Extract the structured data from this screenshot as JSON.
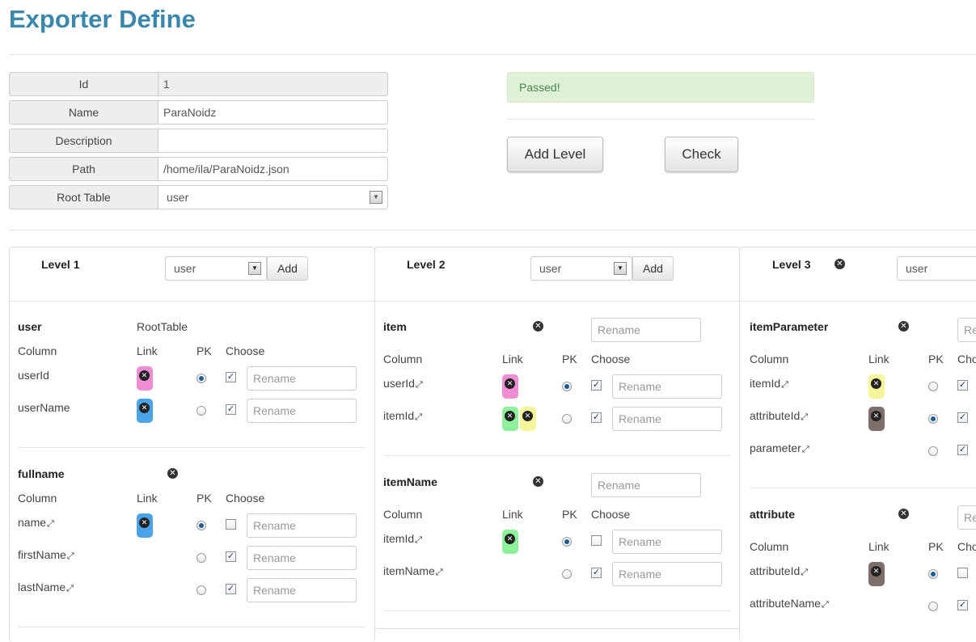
{
  "title": "Exporter Define",
  "form": {
    "id_label": "Id",
    "id_value": "1",
    "name_label": "Name",
    "name_value": "ParaNoidz",
    "description_label": "Description",
    "description_value": "",
    "path_label": "Path",
    "path_value": "/home/ila/ParaNoidz.json",
    "root_table_label": "Root Table",
    "root_table_value": "user"
  },
  "status": {
    "message": "Passed!"
  },
  "buttons": {
    "add_level": "Add Level",
    "check": "Check"
  },
  "colors": {
    "heading": "#3a87ad",
    "alert_bg": "#dff0d8",
    "alert_text": "#468847",
    "chip_pink": "#f08cd4",
    "chip_blue": "#4aa3e8",
    "chip_yellow": "#f5f59a",
    "chip_green": "#8ef09a",
    "chip_brown": "#7e6f6b"
  },
  "common": {
    "column_header": "Column",
    "link_header": "Link",
    "pk_header": "PK",
    "choose_header": "Choose",
    "rename_placeholder": "Rename",
    "remove_icon": "⊗",
    "add_label": "Add",
    "linked_icon": "link-icon"
  },
  "levels": [
    {
      "label": "Level 1",
      "table_select": "user",
      "tables": [
        {
          "name": "user",
          "tag": "RootTable"
        },
        {
          "name": "fullname"
        }
      ]
    },
    {
      "label": "Level 2",
      "table_select": "user",
      "tables": [
        {
          "name": "item"
        },
        {
          "name": "itemName"
        }
      ]
    },
    {
      "label": "Level 3",
      "table_select": "user",
      "tables": [
        {
          "name": "itemParameter"
        },
        {
          "name": "attribute"
        }
      ]
    }
  ],
  "columns": {
    "l1_user": [
      "userId",
      "userName"
    ],
    "l1_fullname": [
      "name",
      "firstName",
      "lastName"
    ],
    "l2_item": [
      "userId",
      "itemId"
    ],
    "l2_itemName": [
      "itemId",
      "itemName"
    ],
    "l3_itemParameter": [
      "itemId",
      "attributeId",
      "parameter"
    ],
    "l3_attribute": [
      "attributeId",
      "attributeName"
    ]
  },
  "truncated": {
    "rename": "Re",
    "choose": "Cho"
  }
}
